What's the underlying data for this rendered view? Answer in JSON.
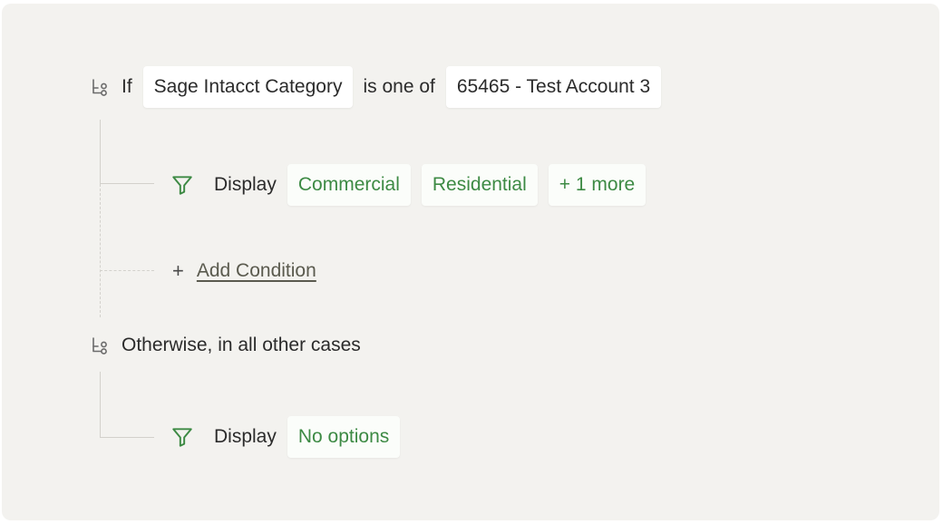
{
  "rule_if": {
    "keyword": "If",
    "field": "Sage Intacct Category",
    "operator": "is one of",
    "value": "65465 - Test Account 3",
    "icon": "branch-icon"
  },
  "rule_if_action": {
    "icon": "filter-icon",
    "label": "Display",
    "options": [
      "Commercial",
      "Residential"
    ],
    "more": "+ 1 more"
  },
  "add_condition": {
    "plus": "+",
    "label": "Add Condition"
  },
  "rule_otherwise": {
    "icon": "branch-icon",
    "label": "Otherwise, in all other cases"
  },
  "rule_otherwise_action": {
    "icon": "filter-icon",
    "label": "Display",
    "value": "No options"
  },
  "colors": {
    "panel_bg": "#f3f2ef",
    "chip_green_text": "#3d8a44",
    "connector": "#d3d1cc"
  }
}
